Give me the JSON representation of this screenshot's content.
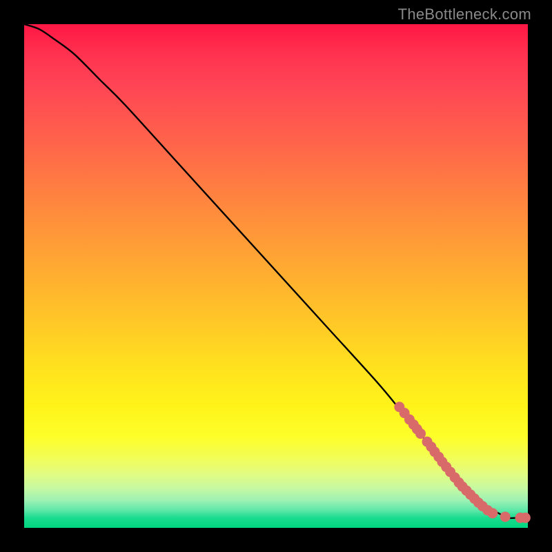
{
  "watermark": "TheBottleneck.com",
  "chart_data": {
    "type": "line",
    "title": "",
    "xlabel": "",
    "ylabel": "",
    "xlim": [
      0,
      100
    ],
    "ylim": [
      0,
      100
    ],
    "grid": false,
    "legend": false,
    "series": [
      {
        "name": "bottleneck-curve",
        "x": [
          0,
          3,
          6,
          10,
          15,
          20,
          30,
          40,
          50,
          60,
          70,
          75,
          80,
          83,
          86,
          88,
          90,
          92,
          94,
          96,
          98,
          100
        ],
        "y": [
          100,
          99,
          97,
          94,
          89,
          84,
          73,
          62,
          51,
          40,
          29,
          23,
          17,
          13,
          10,
          8,
          6,
          4,
          3,
          2,
          2,
          2
        ]
      }
    ],
    "markers": [
      {
        "name": "dot-cluster",
        "color": "#d96a6a",
        "points": [
          {
            "x": 74.5,
            "y": 24.0
          },
          {
            "x": 75.5,
            "y": 22.8
          },
          {
            "x": 76.5,
            "y": 21.5
          },
          {
            "x": 77.3,
            "y": 20.5
          },
          {
            "x": 78.0,
            "y": 19.6
          },
          {
            "x": 78.7,
            "y": 18.7
          },
          {
            "x": 80.0,
            "y": 17.1
          },
          {
            "x": 80.8,
            "y": 16.1
          },
          {
            "x": 81.5,
            "y": 15.1
          },
          {
            "x": 82.3,
            "y": 14.1
          },
          {
            "x": 83.0,
            "y": 13.1
          },
          {
            "x": 83.8,
            "y": 12.1
          },
          {
            "x": 84.6,
            "y": 11.1
          },
          {
            "x": 85.5,
            "y": 10.0
          },
          {
            "x": 86.3,
            "y": 9.0
          },
          {
            "x": 87.0,
            "y": 8.2
          },
          {
            "x": 87.8,
            "y": 7.4
          },
          {
            "x": 88.6,
            "y": 6.6
          },
          {
            "x": 89.4,
            "y": 5.8
          },
          {
            "x": 90.2,
            "y": 5.0
          },
          {
            "x": 91.0,
            "y": 4.3
          },
          {
            "x": 92.0,
            "y": 3.5
          },
          {
            "x": 93.0,
            "y": 2.9
          },
          {
            "x": 95.5,
            "y": 2.2
          },
          {
            "x": 98.5,
            "y": 2.0
          },
          {
            "x": 99.5,
            "y": 2.0
          }
        ]
      }
    ]
  }
}
